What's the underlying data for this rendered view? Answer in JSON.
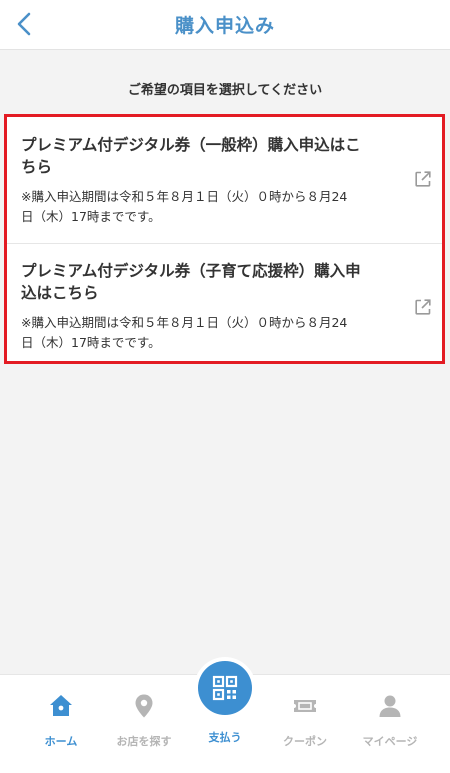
{
  "header": {
    "title": "購入申込み",
    "back_icon": "chevron-left-icon"
  },
  "main": {
    "instruction": "ご希望の項目を選択してください",
    "items": [
      {
        "title_line1": "プレミアム付デジタル券（一般枠）購入申込はこ",
        "title_line2": "ちら",
        "note_line1": "※購入申込期間は令和５年８月１日（火）０時から８月24",
        "note_line2": "日（木）17時までです。",
        "icon": "external-link-icon"
      },
      {
        "title_line1": "プレミアム付デジタル券（子育て応援枠）購入申",
        "title_line2": "込はこちら",
        "note_line1": "※購入申込期間は令和５年８月１日（火）０時から８月24",
        "note_line2": "日（木）17時までです。",
        "icon": "external-link-icon"
      }
    ]
  },
  "bottom_nav": {
    "items": [
      {
        "label": "ホーム",
        "icon": "home-icon",
        "active": true
      },
      {
        "label": "お店を探す",
        "icon": "map-pin-icon",
        "active": false
      },
      {
        "label": "支払う",
        "icon": "qr-code-icon",
        "active": false
      },
      {
        "label": "クーポン",
        "icon": "ticket-icon",
        "active": false
      },
      {
        "label": "マイページ",
        "icon": "user-icon",
        "active": false
      }
    ]
  },
  "colors": {
    "accent": "#3d8fd1",
    "header_title": "#4a90c8",
    "highlight_border": "#e31b23",
    "inactive": "#b5b5b5"
  }
}
